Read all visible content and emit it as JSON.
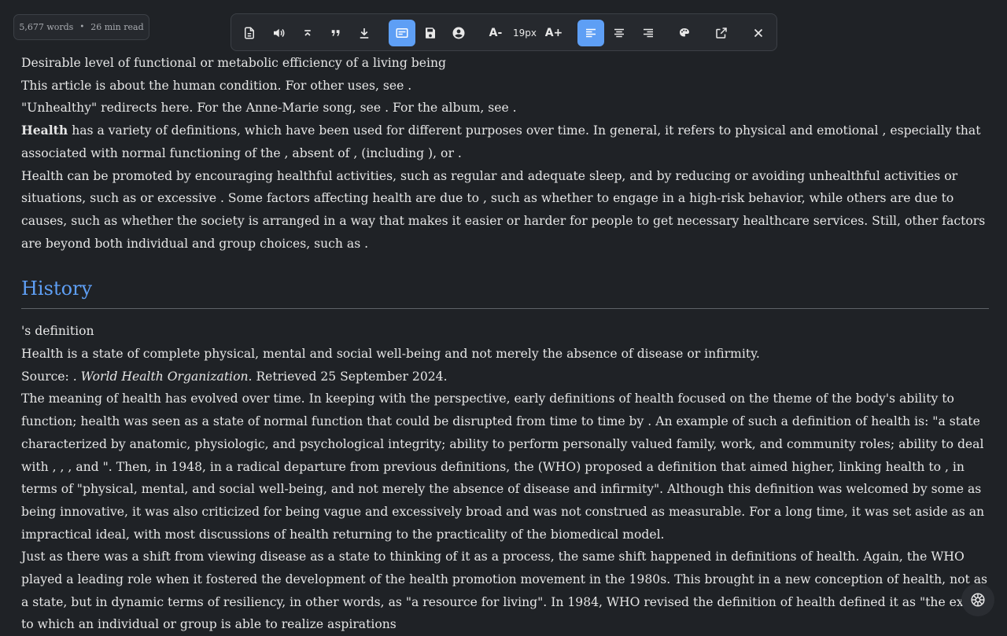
{
  "stats": {
    "words": "5,677 words",
    "separator": "•",
    "read_time": "26 min read"
  },
  "toolbar": {
    "font_size_label": "19px",
    "decrease_font_label": "A-",
    "increase_font_label": "A+",
    "accent_color": "#5e9ff5",
    "icons": [
      "document-icon",
      "speaker-icon",
      "collapse-up-icon",
      "quote-icon",
      "download-icon",
      "reader-mode-icon",
      "save-icon",
      "account-icon",
      "align-left-icon",
      "align-center-icon",
      "align-right-icon",
      "theme-icon",
      "open-external-icon",
      "close-icon"
    ]
  },
  "article": {
    "hatnotes": [
      "Desirable level of functional or metabolic efficiency of a living being",
      "This article is about the human condition. For other uses, see .",
      "\"Unhealthy\" redirects here. For the Anne-Marie song, see . For the album, see ."
    ],
    "lead_bold": "Health",
    "lead_rest": " has a variety of definitions, which have been used for different purposes over time. In general, it refers to physical and emotional , especially that associated with normal functioning of the , absent of , (including ), or .",
    "para2": "Health can be promoted by encouraging healthful activities, such as regular and adequate sleep, and by reducing or avoiding unhealthful activities or situations, such as or excessive . Some factors affecting health are due to , such as whether to engage in a high-risk behavior, while others are due to causes, such as whether the society is arranged in a way that makes it easier or harder for people to get necessary healthcare services. Still, other factors are beyond both individual and group choices, such as .",
    "section_title": "History",
    "def_caption": "'s definition",
    "quote": "Health is a state of complete physical, mental and social well-being and not merely the absence of disease or infirmity.",
    "source_prefix": "Source: . ",
    "source_italic": "World Health Organization",
    "source_suffix": ". Retrieved 25 September 2024.",
    "para3": "The meaning of health has evolved over time. In keeping with the perspective, early definitions of health focused on the theme of the body's ability to function; health was seen as a state of normal function that could be disrupted from time to time by . An example of such a definition of health is: \"a state characterized by anatomic, physiologic, and psychological integrity; ability to perform personally valued family, work, and community roles; ability to deal with , , , and \". Then, in 1948, in a radical departure from previous definitions, the (WHO) proposed a definition that aimed higher, linking health to , in terms of \"physical, mental, and social well-being, and not merely the absence of disease and infirmity\". Although this definition was welcomed by some as being innovative, it was also criticized for being vague and excessively broad and was not construed as measurable. For a long time, it was set aside as an impractical ideal, with most discussions of health returning to the practicality of the biomedical model.",
    "para4": "Just as there was a shift from viewing disease as a state to thinking of it as a process, the same shift happened in definitions of health. Again, the WHO played a leading role when it fostered the development of the health promotion movement in the 1980s. This brought in a new conception of health, not as a state, but in dynamic terms of resiliency, in other words, as \"a resource for living\". In 1984, WHO revised the definition of health defined it as \"the extent to which an individual or group is able to realize aspirations"
  },
  "fab": {
    "icon": "settings-wheel-icon"
  }
}
